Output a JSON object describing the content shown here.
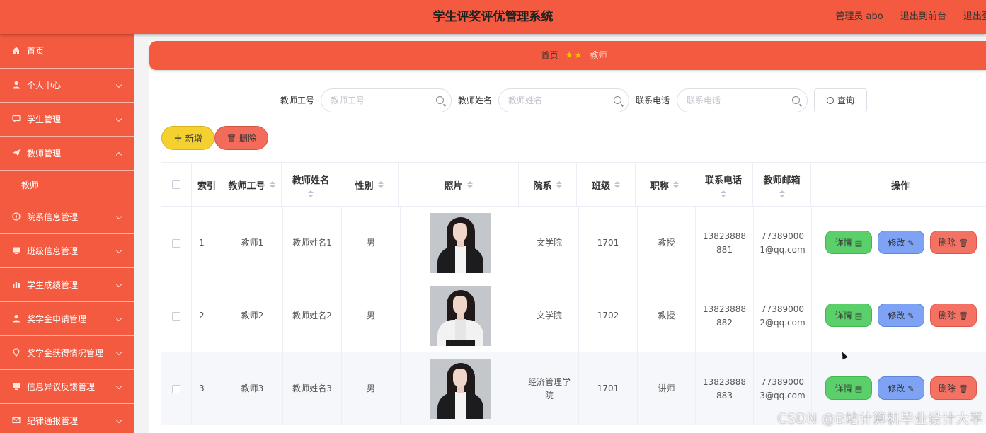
{
  "header": {
    "title": "学生评奖评优管理系统",
    "links": [
      "管理员 abo",
      "退出到前台",
      "退出登录"
    ]
  },
  "sidebar": {
    "items": [
      {
        "label": "首页",
        "icon": "home-icon"
      },
      {
        "label": "个人中心",
        "icon": "user-icon"
      },
      {
        "label": "学生管理",
        "icon": "chat-icon"
      },
      {
        "label": "教师管理",
        "icon": "send-icon",
        "expanded": true,
        "children": [
          "教师"
        ]
      },
      {
        "label": "院系信息管理",
        "icon": "compass-icon"
      },
      {
        "label": "班级信息管理",
        "icon": "monitor-icon"
      },
      {
        "label": "学生成绩管理",
        "icon": "bar-chart-icon"
      },
      {
        "label": "奖学金申请管理",
        "icon": "user-icon"
      },
      {
        "label": "奖学金获得情况管理",
        "icon": "location-icon"
      },
      {
        "label": "信息异议反馈管理",
        "icon": "monitor-icon"
      },
      {
        "label": "纪律通报管理",
        "icon": "mail-icon"
      }
    ]
  },
  "breadcrumb": {
    "home": "首页",
    "current": "教师"
  },
  "search": {
    "fields": [
      {
        "label": "教师工号",
        "placeholder": "教师工号"
      },
      {
        "label": "教师姓名",
        "placeholder": "教师姓名"
      },
      {
        "label": "联系电话",
        "placeholder": "联系电话"
      }
    ],
    "query_label": "查询"
  },
  "toolbar": {
    "add_label": "新增",
    "delete_label": "删除"
  },
  "table": {
    "columns": [
      "索引",
      "教师工号",
      "教师姓名",
      "性别",
      "照片",
      "院系",
      "班级",
      "职称",
      "联系电话",
      "教师邮箱",
      "操作"
    ],
    "rows": [
      {
        "index": "1",
        "id": "教师1",
        "name": "教师姓名1",
        "gender": "男",
        "photo": "dark",
        "dept": "文学院",
        "class": "1701",
        "title": "教授",
        "phone": "13823888881",
        "email": "773890001@qq.com"
      },
      {
        "index": "2",
        "id": "教师2",
        "name": "教师姓名2",
        "gender": "男",
        "photo": "white",
        "dept": "文学院",
        "class": "1702",
        "title": "教授",
        "phone": "13823888882",
        "email": "773890002@qq.com"
      },
      {
        "index": "3",
        "id": "教师3",
        "name": "教师姓名3",
        "gender": "男",
        "photo": "dark",
        "dept": "经济管理学院",
        "class": "1701",
        "title": "讲师",
        "phone": "13823888883",
        "email": "773890003@qq.com"
      }
    ],
    "actions": {
      "detail": "详情",
      "edit": "修改",
      "delete": "删除"
    }
  },
  "watermark": "CSDN @B站计算机毕业设计大学"
}
